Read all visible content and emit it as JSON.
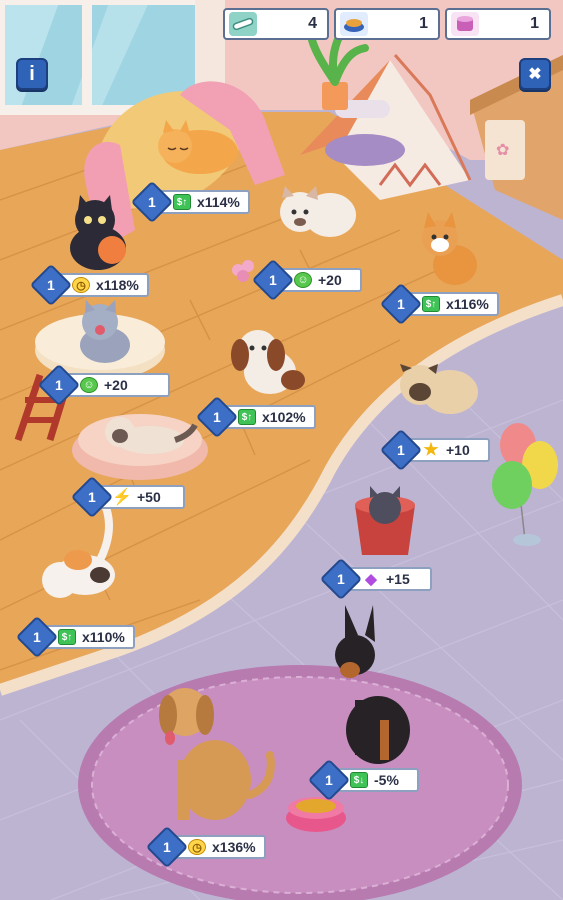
{
  "resources": [
    {
      "icon": "treat-stick-icon",
      "value": "4"
    },
    {
      "icon": "food-bowl-icon",
      "value": "1"
    },
    {
      "icon": "cat-food-can-icon",
      "value": "1"
    }
  ],
  "buttons": {
    "info_label": "i",
    "close_label": "✖"
  },
  "pets": [
    {
      "name": "orange-cat-sleeping",
      "level": "1",
      "bonus_icon": "cash-up-icon",
      "bonus": "x114%"
    },
    {
      "name": "black-cat",
      "level": "1",
      "bonus_icon": "clock-icon",
      "bonus": "x118%"
    },
    {
      "name": "french-bulldog",
      "level": "1",
      "bonus_icon": "smile-icon",
      "bonus": "+20"
    },
    {
      "name": "corgi",
      "level": "1",
      "bonus_icon": "cash-up-icon",
      "bonus": "x116%"
    },
    {
      "name": "gray-tabby-cat",
      "level": "1",
      "bonus_icon": "smile-icon",
      "bonus": "+20"
    },
    {
      "name": "spaniel-puppy",
      "level": "1",
      "bonus_icon": "cash-up-icon",
      "bonus": "x102%"
    },
    {
      "name": "pug",
      "level": "1",
      "bonus_icon": "star-icon",
      "bonus": "+10"
    },
    {
      "name": "siamese-cat",
      "level": "1",
      "bonus_icon": "lightning-icon",
      "bonus": "+50"
    },
    {
      "name": "gray-cat-in-bucket",
      "level": "1",
      "bonus_icon": "gem-icon",
      "bonus": "+15"
    },
    {
      "name": "calico-cat",
      "level": "1",
      "bonus_icon": "cash-up-icon",
      "bonus": "x110%"
    },
    {
      "name": "doberman",
      "level": "1",
      "bonus_icon": "cash-down-icon",
      "bonus": "-5%"
    },
    {
      "name": "golden-retriever",
      "level": "1",
      "bonus_icon": "clock-icon",
      "bonus": "x136%"
    }
  ],
  "colors": {
    "floor_wood": "#e9a95a",
    "floor_tile": "#b9b0cf",
    "rug": "#c98fc0",
    "wall": "#f3c8c4",
    "tag_blue": "#3e6fc6"
  }
}
